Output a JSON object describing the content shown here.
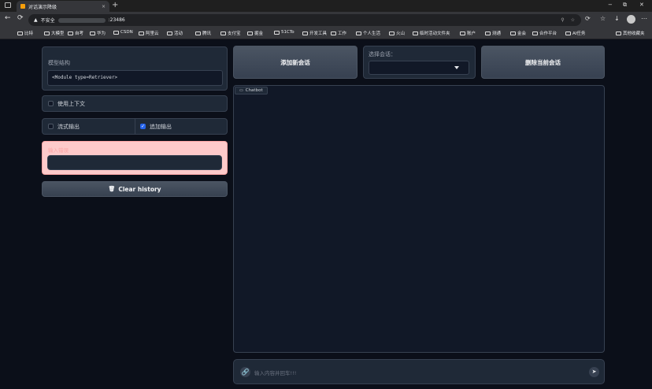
{
  "browser": {
    "tab_title": "对话演示降级",
    "close": "×",
    "new_tab": "+",
    "minimize": "−",
    "restore": "⧉",
    "win_close": "✕",
    "back": "←",
    "reload": "⟳",
    "insecure_label": "不安全",
    "address_suffix": ":23486",
    "icons": [
      "tabs-icon",
      "back-icon",
      "reload-icon",
      "lock-warning-icon",
      "extensions-icon",
      "favorite-icon",
      "copilot-icon",
      "download-icon",
      "profile-icon",
      "more-icon"
    ],
    "bookmarks": [
      "比特",
      "大模型",
      "自考",
      "华为",
      "CSDN",
      "阿里云",
      "活动",
      "腾讯",
      "支付宝",
      "掘金",
      "51CTo",
      "开发工具",
      "工作",
      "个人生活",
      "火山",
      "临时活动文件夹",
      "账户",
      "测通",
      "金会",
      "合作平台",
      "AI任务"
    ],
    "other_bookmarks": "其他收藏夹"
  },
  "left": {
    "model_label": "模型结构",
    "model_value": "<Module type=Retriever>",
    "use_context": "使用上下文",
    "stream_output": "流式输出",
    "append_output": "追加输出",
    "append_checked": "✓",
    "error_label": "输入错误",
    "clear_history": "Clear history",
    "clear_icon": "🗑"
  },
  "right": {
    "add_session": "添加新会话",
    "select_label": "选择会话：",
    "delete_session": "删除当前会话",
    "chatbot_label": "Chatbot",
    "input_placeholder": "输入内容并回车!!!",
    "attach_icon": "🔗",
    "send_icon": "➤"
  },
  "colors": {
    "background": "#0b0f19",
    "panel": "#1f2937",
    "error_panel": "#fecaca",
    "checkbox_on": "#2563eb"
  }
}
